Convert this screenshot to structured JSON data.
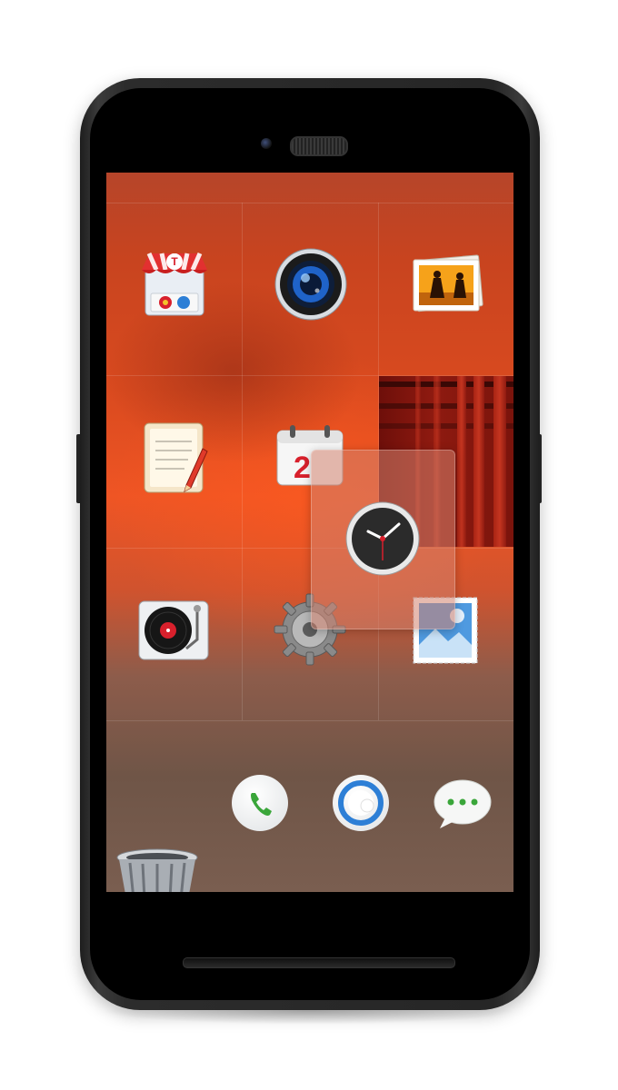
{
  "home_screen": {
    "apps": [
      {
        "id": "store",
        "icon": "shopping-bag-icon"
      },
      {
        "id": "camera",
        "icon": "camera-icon"
      },
      {
        "id": "gallery",
        "icon": "photo-gallery-icon"
      },
      {
        "id": "notes",
        "icon": "notepad-icon"
      },
      {
        "id": "calendar",
        "icon": "calendar-icon",
        "day": "2"
      },
      {
        "id": "music",
        "icon": "turntable-icon"
      },
      {
        "id": "settings",
        "icon": "gear-icon"
      },
      {
        "id": "weather",
        "icon": "postage-stamp-icon"
      }
    ],
    "widgets": {
      "photo_widget": "photo-frame-widget",
      "dragged_clock": "clock-icon"
    },
    "dock": [
      {
        "id": "phone",
        "icon": "phone-icon"
      },
      {
        "id": "browser",
        "icon": "browser-icon"
      },
      {
        "id": "messages",
        "icon": "messages-icon"
      }
    ],
    "trash": "trash-can-icon"
  },
  "colors": {
    "wallpaper_top": "#b6452a",
    "wallpaper_mid": "#ef5524",
    "wallpaper_bottom": "#6f5547",
    "phone_frame": "#262626",
    "accent_red": "#d8202c",
    "accent_blue": "#2d7fd6",
    "phone_green": "#3aa63a"
  }
}
